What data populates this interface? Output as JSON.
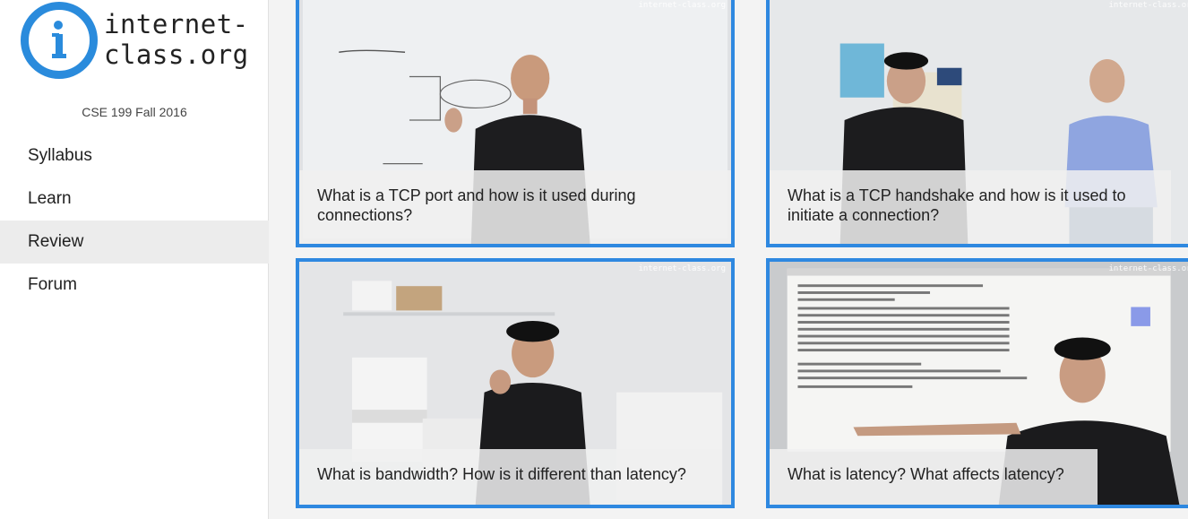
{
  "logo": {
    "line1": "internet-",
    "line2": "class.org"
  },
  "course": "CSE 199 Fall 2016",
  "nav": [
    {
      "label": "Syllabus"
    },
    {
      "label": "Learn"
    },
    {
      "label": "Review"
    },
    {
      "label": "Forum"
    }
  ],
  "videos": [
    {
      "watermark": "internet-class.org",
      "caption": "What is a TCP port and how is it used during connections?"
    },
    {
      "watermark": "internet-class.org",
      "caption": "What is a TCP handshake and how is it used to initiate a connection?"
    },
    {
      "watermark": "internet-class.org",
      "caption": "What is bandwidth? How is it different than latency?"
    },
    {
      "watermark": "internet-class.org",
      "caption": "What is latency? What affects latency?"
    }
  ],
  "colors": {
    "accent": "#2a8bdc",
    "card_border": "#2e88e0",
    "active_nav": "#ececec"
  }
}
